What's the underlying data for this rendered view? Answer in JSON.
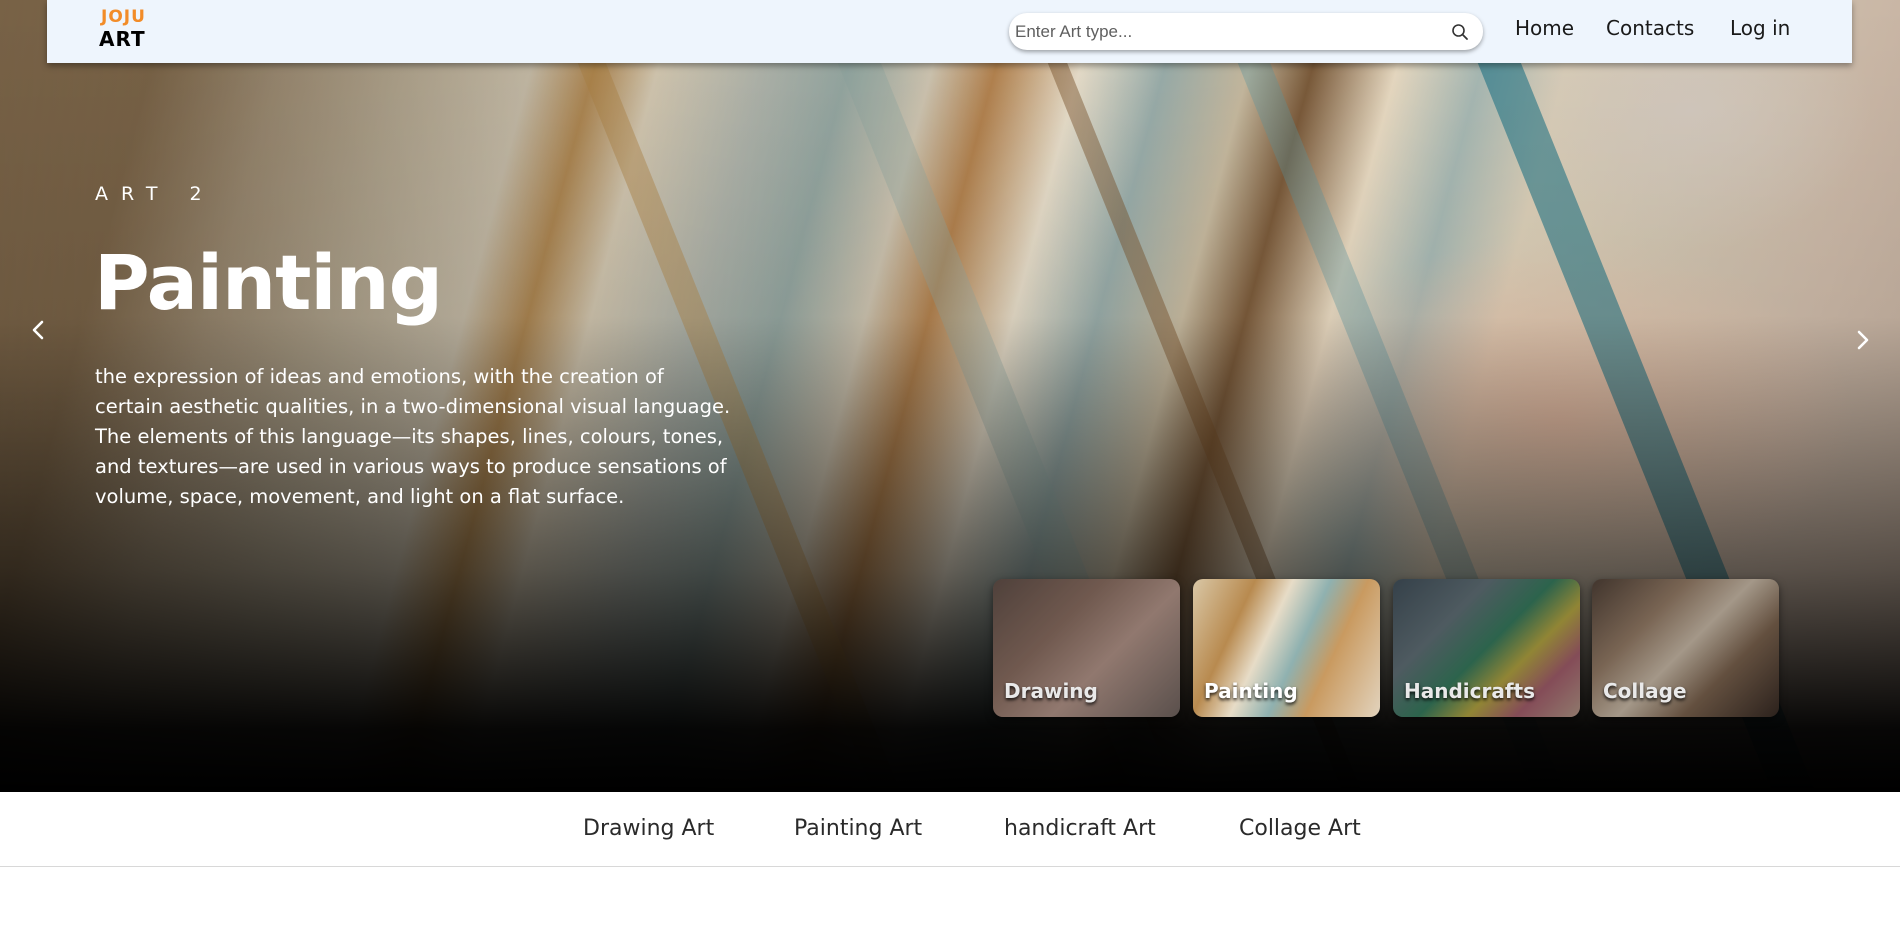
{
  "logo": {
    "line1": "JOJU",
    "line2": "ART"
  },
  "search": {
    "placeholder": "Enter Art type..."
  },
  "nav": {
    "home": "Home",
    "contacts": "Contacts",
    "login": "Log in"
  },
  "hero": {
    "eyebrow": "ART 2",
    "title": "Painting",
    "description": "the expression of ideas and emotions, with the creation of certain aesthetic qualities, in a two-dimensional visual language. The elements of this language—its shapes, lines, colours, tones, and textures—are used in various ways to produce sensations of volume, space, movement, and light on a flat surface."
  },
  "thumbnails": [
    {
      "label": "Drawing",
      "active": false
    },
    {
      "label": "Painting",
      "active": true
    },
    {
      "label": "Handicrafts",
      "active": false
    },
    {
      "label": "Collage",
      "active": false
    }
  ],
  "tabs": [
    "Drawing Art",
    "Painting Art",
    "handicraft Art",
    "Collage Art"
  ],
  "colors": {
    "nav_bg": "#eef5fd",
    "logo_orange": "#f28c28",
    "logo_blue": "#1e5aa8"
  },
  "icons": {
    "search": "search-icon",
    "prev": "chevron-left-icon",
    "next": "chevron-right-icon"
  }
}
